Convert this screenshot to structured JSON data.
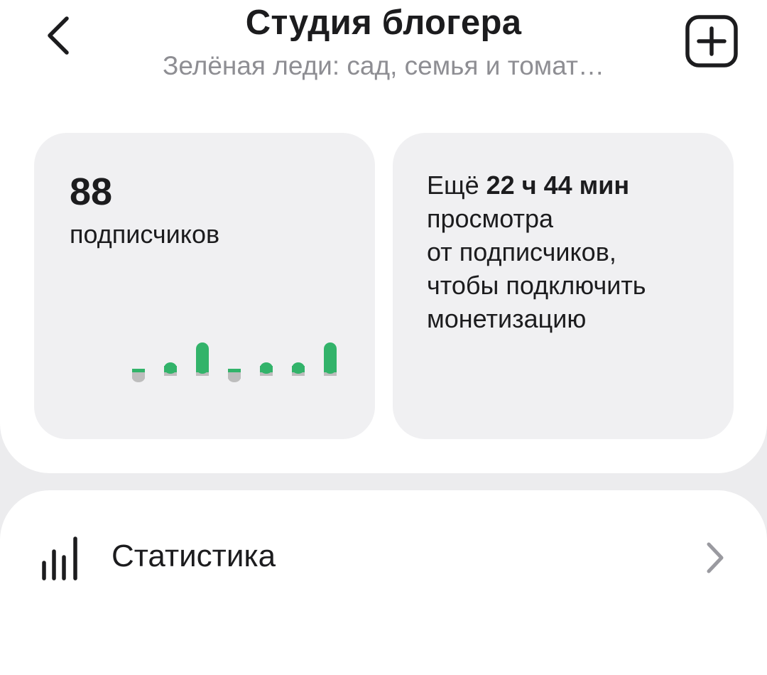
{
  "header": {
    "title": "Студия блогера",
    "subtitle": "Зелёная леди: сад, семья и томат…",
    "back_icon": "chevron-left-icon",
    "add_icon": "plus-square-icon"
  },
  "subscribers_card": {
    "count": "88",
    "label": "подписчиков",
    "chart_data": {
      "type": "bar",
      "values": [
        -1,
        1,
        3,
        -1,
        1,
        1,
        3
      ],
      "colors": {
        "positive": "#32b36a",
        "negative": "#bdbdbd"
      }
    }
  },
  "monetization_card": {
    "prefix": "Ещё ",
    "time": "22 ч 44 мин",
    "lines": [
      "просмотра",
      "от подписчиков,",
      "чтобы подключить",
      "монетизацию"
    ]
  },
  "menu": {
    "statistics_label": "Статистика",
    "statistics_icon": "bar-chart-icon",
    "chevron_icon": "chevron-right-icon"
  },
  "colors": {
    "accent_green": "#32b36a",
    "card_bg": "#f0f0f2",
    "page_bg": "#ececee",
    "muted_text": "#8e8e93"
  }
}
